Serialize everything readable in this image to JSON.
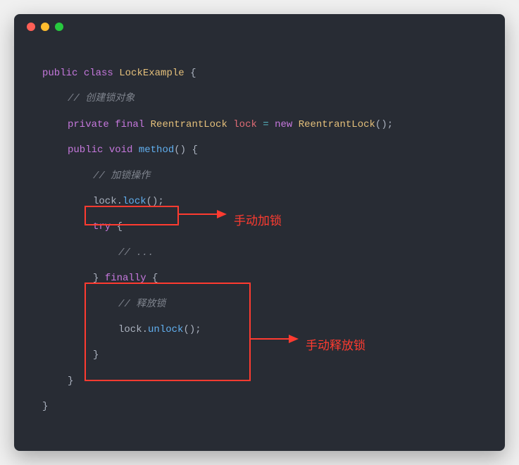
{
  "code": {
    "l1_kw1": "public",
    "l1_kw2": "class",
    "l1_name": "LockExample",
    "l1_brace": " {",
    "l2_comment": "// 创建锁对象",
    "l3_kw1": "private",
    "l3_kw2": "final",
    "l3_type1": "ReentrantLock",
    "l3_var": " lock ",
    "l3_op": "=",
    "l3_kw3": " new",
    "l3_type2": " ReentrantLock",
    "l3_paren": "();",
    "l4_kw1": "public",
    "l4_kw2": "void",
    "l4_fn": "method",
    "l4_paren": "() {",
    "l5_comment": "// 加锁操作",
    "l6_obj": "lock.",
    "l6_fn": "lock",
    "l6_paren": "();",
    "l7_kw": "try",
    "l7_brace": " {",
    "l8_comment": "// ...",
    "l9_brace": "} ",
    "l9_kw": "finally",
    "l9_brace2": " {",
    "l10_comment": "// 释放锁",
    "l11_obj": "lock.",
    "l11_fn": "unlock",
    "l11_paren": "();",
    "l12_brace": "}",
    "l13_brace": "}",
    "l14_brace": "}"
  },
  "annotations": {
    "a1": "手动加锁",
    "a2": "手动释放锁"
  }
}
